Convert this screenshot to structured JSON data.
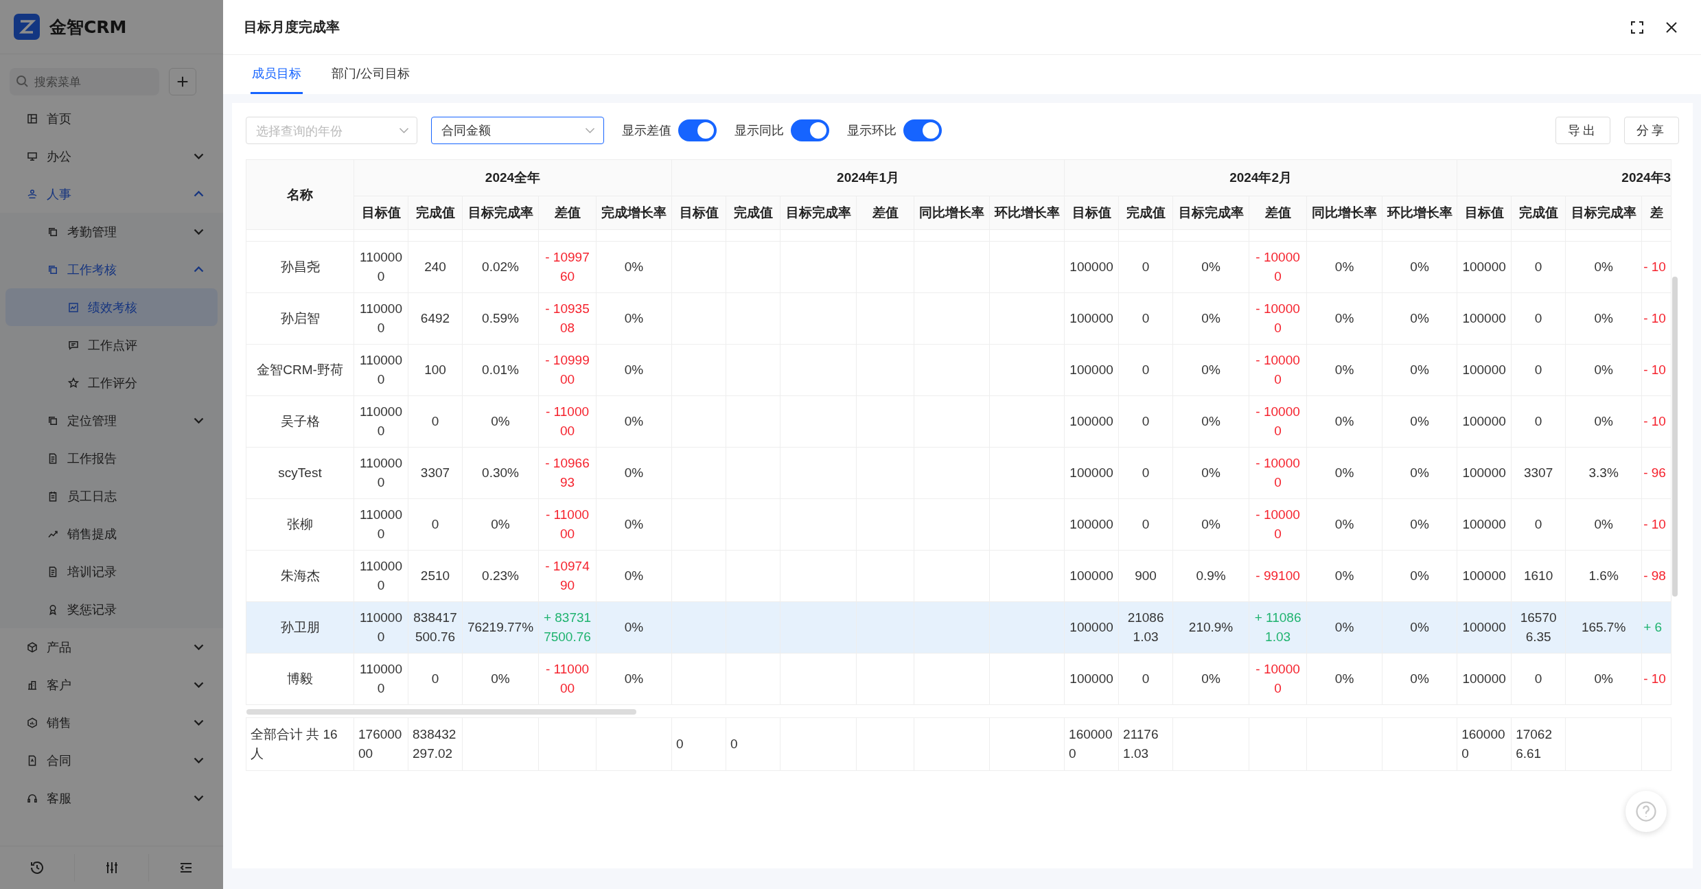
{
  "sidebar": {
    "logo": "金智CRM",
    "search": {
      "placeholder": "搜索菜单"
    },
    "menu": [
      {
        "label": "首页",
        "kind": "link",
        "selected": false
      },
      {
        "label": "办公",
        "kind": "group",
        "expanded": false,
        "selected": false
      },
      {
        "label": "人事",
        "kind": "group",
        "expanded": true,
        "selected": false,
        "children": [
          {
            "label": "考勤管理",
            "kind": "group",
            "expanded": false,
            "selected": false
          },
          {
            "label": "工作考核",
            "kind": "group",
            "expanded": true,
            "selected": false,
            "children": [
              {
                "label": "绩效考核",
                "kind": "link",
                "selected": true
              },
              {
                "label": "工作点评",
                "kind": "link",
                "selected": false
              },
              {
                "label": "工作评分",
                "kind": "link",
                "selected": false
              }
            ]
          },
          {
            "label": "定位管理",
            "kind": "group",
            "expanded": false,
            "selected": false
          },
          {
            "label": "工作报告",
            "kind": "link",
            "selected": false
          },
          {
            "label": "员工日志",
            "kind": "link",
            "selected": false
          },
          {
            "label": "销售提成",
            "kind": "link",
            "selected": false
          },
          {
            "label": "培训记录",
            "kind": "link",
            "selected": false
          },
          {
            "label": "奖惩记录",
            "kind": "link",
            "selected": false
          }
        ]
      },
      {
        "label": "产品",
        "kind": "group",
        "expanded": false,
        "selected": false
      },
      {
        "label": "客户",
        "kind": "group",
        "expanded": false,
        "selected": false
      },
      {
        "label": "销售",
        "kind": "group",
        "expanded": false,
        "selected": false
      },
      {
        "label": "合同",
        "kind": "group",
        "expanded": false,
        "selected": false
      },
      {
        "label": "客服",
        "kind": "group",
        "expanded": false,
        "selected": false
      }
    ]
  },
  "panel": {
    "title": "目标月度完成率",
    "tabs": [
      {
        "label": "成员目标",
        "selected": true
      },
      {
        "label": "部门/公司目标",
        "selected": false
      }
    ],
    "year_select": {
      "placeholder": "选择查询的年份"
    },
    "metric_select": {
      "value": "合同金额"
    },
    "toggles": [
      {
        "label": "显示差值",
        "on": true
      },
      {
        "label": "显示同比",
        "on": true
      },
      {
        "label": "显示环比",
        "on": true
      }
    ],
    "buttons": [
      "导出",
      "分享"
    ],
    "table": {
      "name_header": "名称",
      "groups": [
        {
          "title": "2024全年",
          "columns": [
            "目标值",
            "完成值",
            "目标完成率",
            "差值",
            "完成增长率"
          ]
        },
        {
          "title": "2024年1月",
          "columns": [
            "目标值",
            "完成值",
            "目标完成率",
            "差值",
            "同比增长率",
            "环比增长率"
          ]
        },
        {
          "title": "2024年2月",
          "columns": [
            "目标值",
            "完成值",
            "目标完成率",
            "差值",
            "同比增长率",
            "环比增长率"
          ]
        },
        {
          "title": "2024年3",
          "columns": [
            "目标值",
            "完成值",
            "目标完成率",
            "差"
          ]
        }
      ],
      "rows": [
        {
          "name": "孙昌尧",
          "selected": false,
          "cells": [
            "1100000",
            "240",
            "0.02%",
            {
              "text": "- 1099760",
              "negative": true
            },
            "0%",
            null,
            null,
            null,
            null,
            null,
            null,
            "100000",
            "0",
            "0%",
            {
              "text": "- 100000",
              "negative": true
            },
            "0%",
            "0%",
            "100000",
            "0",
            "0%",
            {
              "text": "- 10",
              "negative": true
            }
          ]
        },
        {
          "name": "孙启智",
          "selected": false,
          "cells": [
            "1100000",
            "6492",
            "0.59%",
            {
              "text": "- 1093508",
              "negative": true
            },
            "0%",
            null,
            null,
            null,
            null,
            null,
            null,
            "100000",
            "0",
            "0%",
            {
              "text": "- 100000",
              "negative": true
            },
            "0%",
            "0%",
            "100000",
            "0",
            "0%",
            {
              "text": "- 10",
              "negative": true
            }
          ]
        },
        {
          "name": "金智CRM-野荷",
          "selected": false,
          "cells": [
            "1100000",
            "100",
            "0.01%",
            {
              "text": "- 1099900",
              "negative": true
            },
            "0%",
            null,
            null,
            null,
            null,
            null,
            null,
            "100000",
            "0",
            "0%",
            {
              "text": "- 100000",
              "negative": true
            },
            "0%",
            "0%",
            "100000",
            "0",
            "0%",
            {
              "text": "- 10",
              "negative": true
            }
          ]
        },
        {
          "name": "吴子格",
          "selected": false,
          "cells": [
            "1100000",
            "0",
            "0%",
            {
              "text": "- 1100000",
              "negative": true
            },
            "0%",
            null,
            null,
            null,
            null,
            null,
            null,
            "100000",
            "0",
            "0%",
            {
              "text": "- 100000",
              "negative": true
            },
            "0%",
            "0%",
            "100000",
            "0",
            "0%",
            {
              "text": "- 10",
              "negative": true
            }
          ]
        },
        {
          "name": "scyTest",
          "selected": false,
          "cells": [
            "1100000",
            "3307",
            "0.30%",
            {
              "text": "- 1096693",
              "negative": true
            },
            "0%",
            null,
            null,
            null,
            null,
            null,
            null,
            "100000",
            "0",
            "0%",
            {
              "text": "- 100000",
              "negative": true
            },
            "0%",
            "0%",
            "100000",
            "3307",
            "3.3%",
            {
              "text": "- 96",
              "negative": true
            }
          ]
        },
        {
          "name": "张柳",
          "selected": false,
          "cells": [
            "1100000",
            "0",
            "0%",
            {
              "text": "- 1100000",
              "negative": true
            },
            "0%",
            null,
            null,
            null,
            null,
            null,
            null,
            "100000",
            "0",
            "0%",
            {
              "text": "- 100000",
              "negative": true
            },
            "0%",
            "0%",
            "100000",
            "0",
            "0%",
            {
              "text": "- 10",
              "negative": true
            }
          ]
        },
        {
          "name": "朱海杰",
          "selected": false,
          "cells": [
            "1100000",
            "2510",
            "0.23%",
            {
              "text": "- 1097490",
              "negative": true
            },
            "0%",
            null,
            null,
            null,
            null,
            null,
            null,
            "100000",
            "900",
            "0.9%",
            {
              "text": "- 99100",
              "negative": true
            },
            "0%",
            "0%",
            "100000",
            "1610",
            "1.6%",
            {
              "text": "- 98",
              "negative": true
            }
          ]
        },
        {
          "name": "孙卫朋",
          "selected": true,
          "cells": [
            "1100000",
            "838417500.76",
            "76219.77%",
            {
              "text": "+ 837317500.76",
              "negative": false
            },
            "0%",
            null,
            null,
            null,
            null,
            null,
            null,
            "100000",
            "210861.03",
            "210.9%",
            {
              "text": "+ 110861.03",
              "negative": false
            },
            "0%",
            "0%",
            "100000",
            "165706.35",
            "165.7%",
            {
              "text": "+ 6",
              "negative": false
            }
          ]
        },
        {
          "name": "博毅",
          "selected": false,
          "cells": [
            "1100000",
            "0",
            "0%",
            {
              "text": "- 1100000",
              "negative": true
            },
            "0%",
            null,
            null,
            null,
            null,
            null,
            null,
            "100000",
            "0",
            "0%",
            {
              "text": "- 100000",
              "negative": true
            },
            "0%",
            "0%",
            "100000",
            "0",
            "0%",
            {
              "text": "- 10",
              "negative": true
            }
          ]
        }
      ],
      "total": {
        "name": "全部合计 共 16 人",
        "cells": [
          "17600000",
          "838432297.02",
          null,
          null,
          null,
          "0",
          "0",
          null,
          null,
          null,
          null,
          "1600000",
          "211761.03",
          null,
          null,
          null,
          null,
          "1600000",
          "170626.61",
          null,
          null
        ]
      }
    }
  }
}
